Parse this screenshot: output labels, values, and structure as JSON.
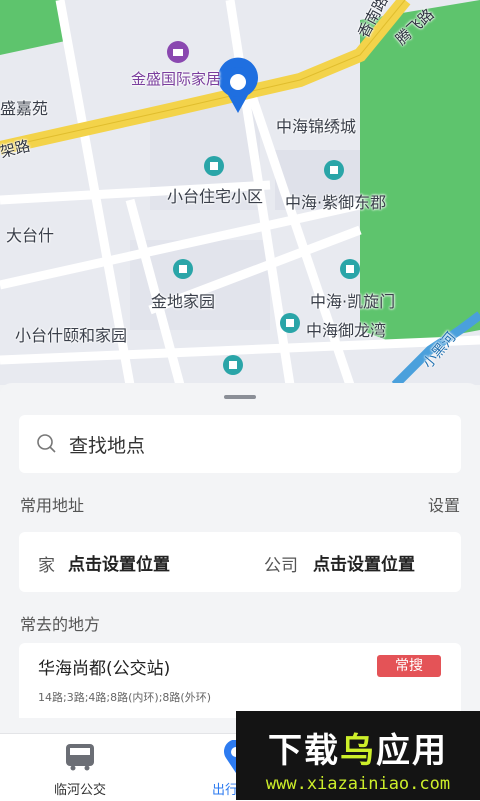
{
  "map": {
    "labels": {
      "jinsheng": "金盛国际家居",
      "tengfei_road": "腾飞路",
      "top_road": "香南路",
      "left_area": "盛嘉苑",
      "jia_road": "架路",
      "zhonghai_jinxiu": "中海锦绣城",
      "xiaotai_residential": "小台住宅小区",
      "zhonghai_ziyu": "中海·紫御东郡",
      "datai": "大台什",
      "jindi": "金地家园",
      "zhonghai_kaixuan": "中海·凯旋门",
      "xiaotai_yihe": "小台什颐和家园",
      "zhonghai_yulong": "中海御龙湾",
      "river": "小黑河"
    }
  },
  "panel": {
    "search_placeholder": "查找地点",
    "common_address_title": "常用地址",
    "settings_label": "设置",
    "home_label": "家",
    "home_value": "点击设置位置",
    "company_label": "公司",
    "company_value": "点击设置位置",
    "frequent_title": "常去的地方",
    "frequent_items": [
      {
        "name": "华海尚都(公交站)",
        "badge": "常搜",
        "routes": "14路;3路;4路;8路(内环);8路(外环)"
      }
    ]
  },
  "tabbar": {
    "tabs": [
      {
        "label": "临河公交",
        "icon": "bus-icon"
      },
      {
        "label": "出行",
        "icon": "location-icon"
      }
    ]
  },
  "watermark": {
    "title_part1": "下载",
    "title_part2": "乌",
    "title_part3": "应用",
    "url": "www.xiazainiao.com"
  },
  "colors": {
    "accent_blue": "#2d7bf0",
    "badge_red": "#e45357",
    "road_yellow": "#f3d34a",
    "park_green": "#5ec46d"
  }
}
